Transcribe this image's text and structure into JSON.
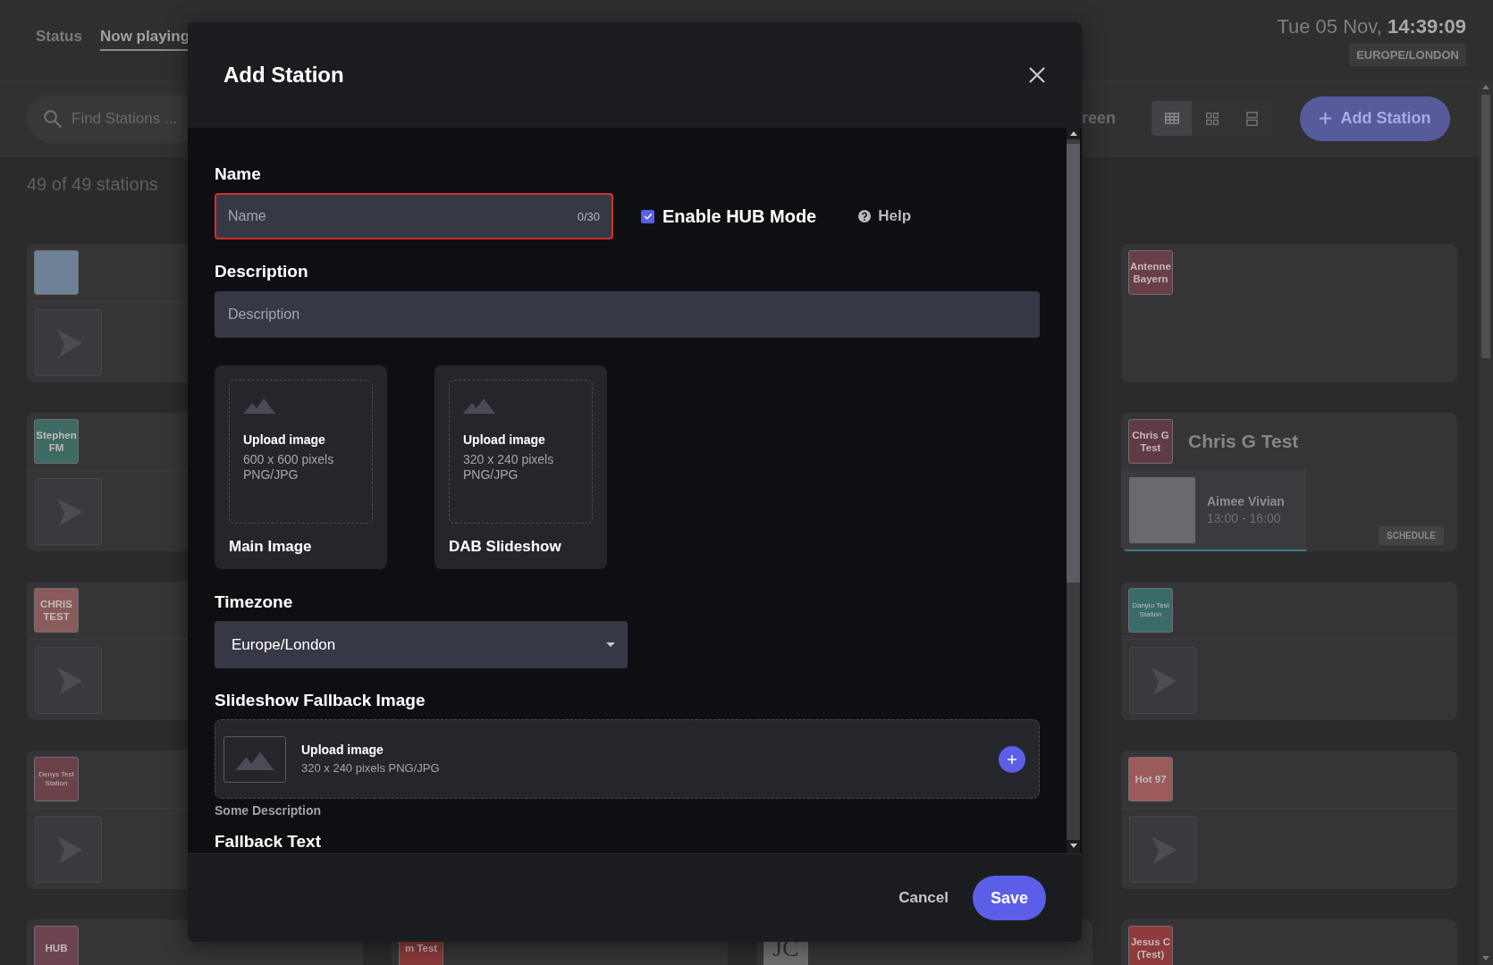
{
  "top_bar": {
    "nav_tabs": [
      {
        "label": "Status",
        "selected": false
      },
      {
        "label": "Now playing",
        "selected": true
      }
    ],
    "datetime": "Tue 05 Nov, **14:39:09**",
    "timezone": "EUROPE/LONDON"
  },
  "toolbar": {
    "search": {
      "placeholder": "Find Stations ..."
    },
    "label_fragment": "reen",
    "view_modes": [
      {
        "kind": "table",
        "selected": true
      },
      {
        "kind": "grid",
        "selected": false
      },
      {
        "kind": "rows",
        "selected": false
      }
    ],
    "add_button": "Add Station"
  },
  "station_count": "49 of 49 stations",
  "station_columns": [
    {
      "cards": [
        {
          "logo": {
            "kind": "picture"
          },
          "body": {
            "kind": "player"
          }
        },
        {
          "logo": {
            "kind": "text",
            "text": "Stephen FM",
            "color": "#3d6b64"
          },
          "body": {
            "kind": "player"
          }
        },
        {
          "logo": {
            "kind": "text",
            "text": "CHRIS TEST",
            "color": "#8a5b5b"
          },
          "body": {
            "kind": "player"
          }
        },
        {
          "logo": {
            "kind": "small_text",
            "text": "Denys Test Station",
            "color": "#6b414a"
          },
          "body": {
            "kind": "player"
          }
        },
        {
          "logo": {
            "kind": "text",
            "text": "HUB",
            "color": "#6d4550"
          }
        }
      ]
    },
    {
      "cards": [
        {
          "logo": {
            "kind": "text",
            "text": "m Test",
            "color": "#8b3a3a"
          }
        }
      ]
    },
    {
      "cards": [
        {
          "logo": {
            "kind": "monogram",
            "text": "JC",
            "color": "#6e6e6e"
          }
        }
      ]
    },
    {
      "cards": [
        {
          "logo": {
            "kind": "text",
            "text": "Antenne Bayern",
            "color": "#6a3e48"
          }
        },
        {
          "logo": {
            "kind": "text",
            "text": "Chris G Test",
            "color": "#603b45"
          },
          "title": "Chris G Test",
          "body": {
            "kind": "now_playing",
            "host": "Aimee Vivian",
            "time": "13:00 - 16:00",
            "badge": "SCHEDULE"
          }
        },
        {
          "logo": {
            "kind": "small_text",
            "text": "Danylo Test Station",
            "color": "#3b6a6a"
          },
          "body": {
            "kind": "player"
          }
        },
        {
          "logo": {
            "kind": "text",
            "text": "Hot 97",
            "color": "#9b5b5b"
          },
          "body": {
            "kind": "player"
          }
        },
        {
          "logo": {
            "kind": "text",
            "text": "Jesus C (Test)",
            "color": "#8f3b3b"
          }
        }
      ]
    }
  ],
  "modal": {
    "title": "Add Station",
    "name_field": {
      "label": "Name",
      "placeholder": "Name",
      "counter": "0/30",
      "invalid": true
    },
    "hub_mode": {
      "label": "Enable HUB Mode",
      "checked": true
    },
    "help": "Help",
    "description_field": {
      "label": "Description",
      "placeholder": "Description"
    },
    "image_uploads": [
      {
        "title": "Main Image",
        "prompt": "Upload image",
        "details": "600 x 600 pixels PNG/JPG"
      },
      {
        "title": "DAB Slideshow",
        "prompt": "Upload image",
        "details": "320 x 240 pixels PNG/JPG"
      }
    ],
    "timezone": {
      "label": "Timezone",
      "value": "Europe/London"
    },
    "fallback_image": {
      "label": "Slideshow Fallback Image",
      "prompt": "Upload image",
      "details": "320 x 240 pixels PNG/JPG",
      "description": "Some Description"
    },
    "fallback_text": {
      "label": "Fallback Text"
    },
    "buttons": [
      {
        "label": "Cancel",
        "kind": "text"
      },
      {
        "label": "Save",
        "kind": "primary"
      }
    ]
  }
}
